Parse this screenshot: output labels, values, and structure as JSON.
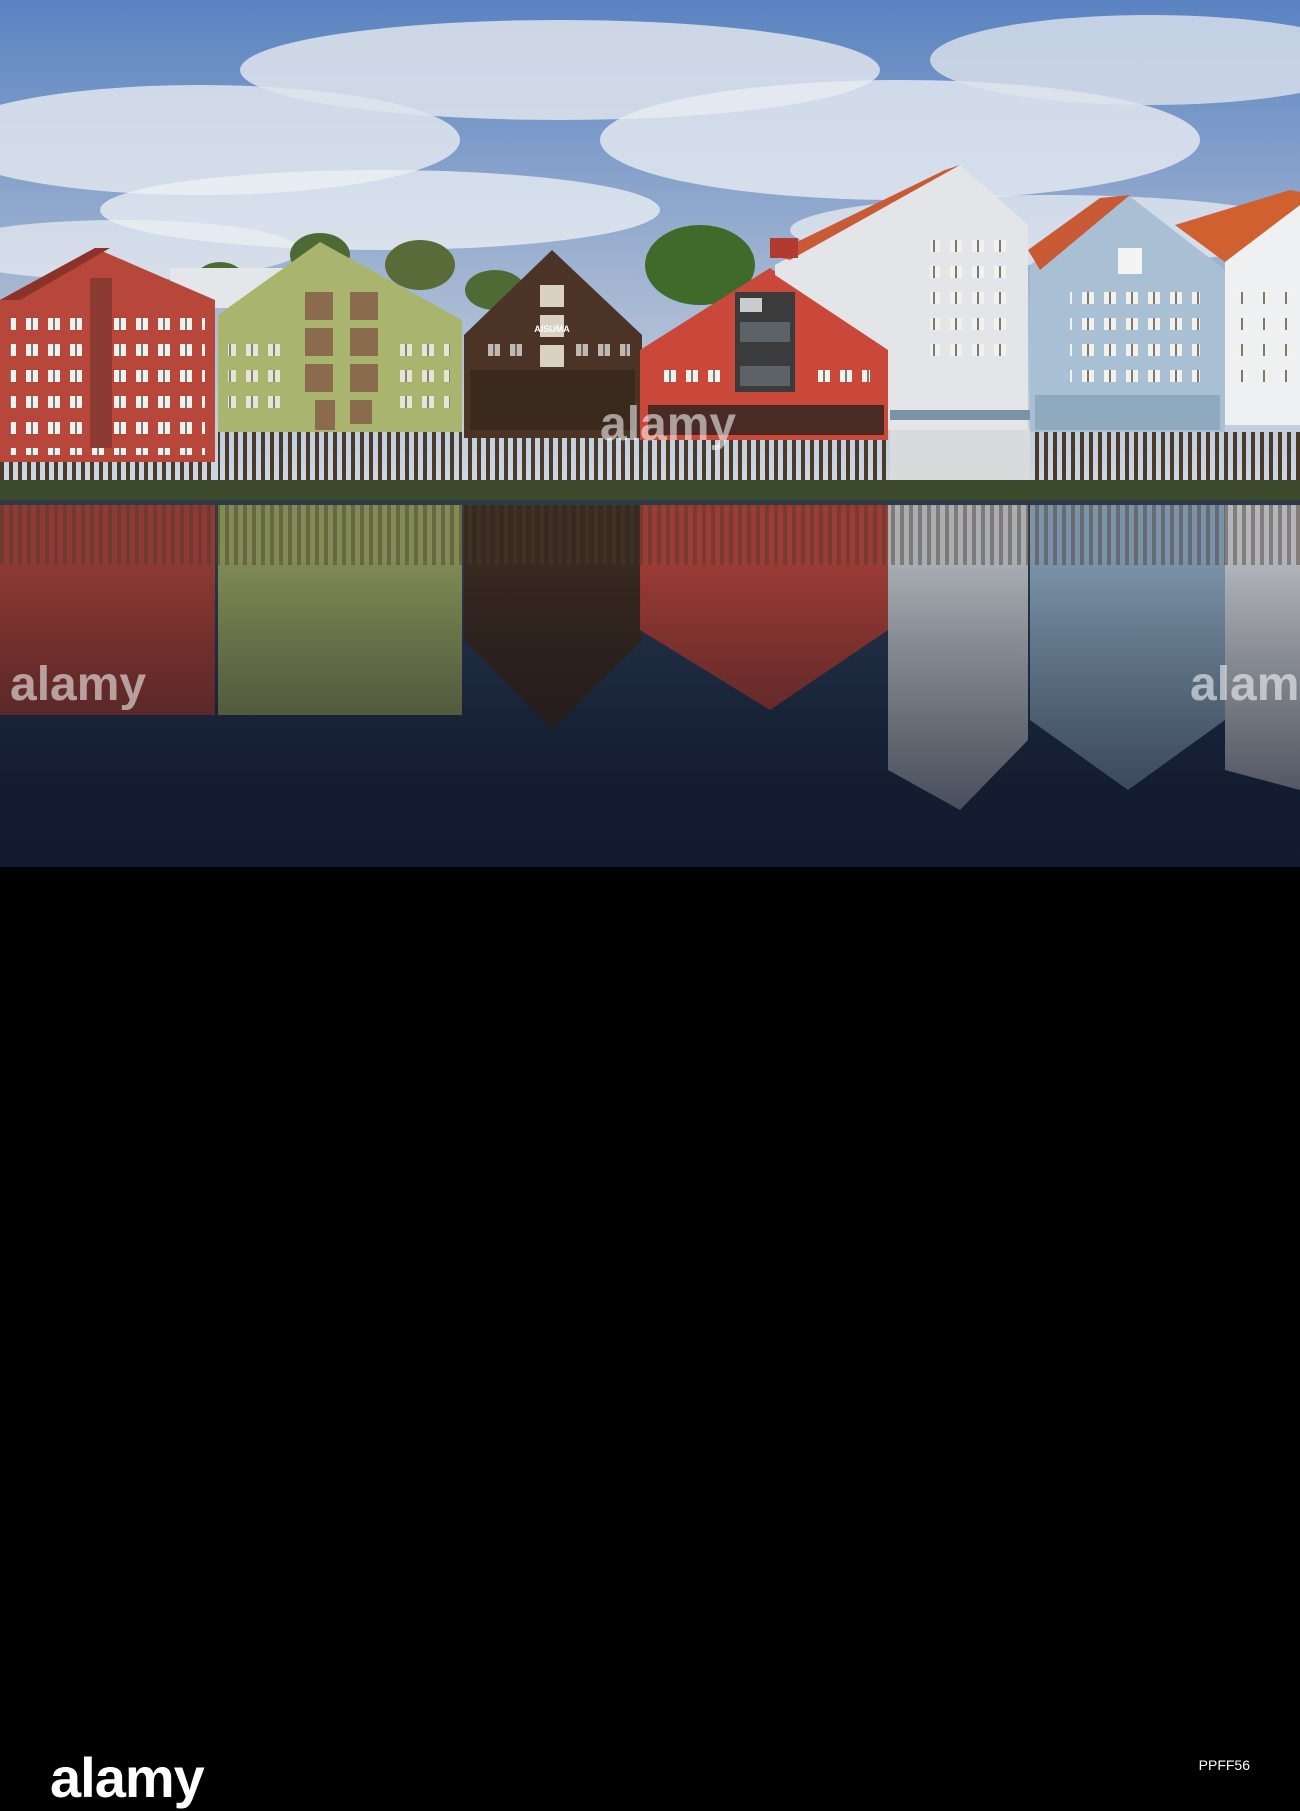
{
  "sign_text": "AISUMA",
  "watermark": "alamy",
  "logo": "alamy",
  "image_id": "PPFF56",
  "colors": {
    "sky_top": "#5f87c2",
    "cloud": "#e4e8ee",
    "red_building": "#b7473a",
    "green_building": "#a9b56e",
    "brown_building": "#4b3426",
    "orange_building": "#c9483a",
    "grey_building": "#e3e5e8",
    "blue_building": "#a9bfd3",
    "white_building": "#eef0f1",
    "roof": "#d0602f",
    "water": "#1f2b3f"
  }
}
